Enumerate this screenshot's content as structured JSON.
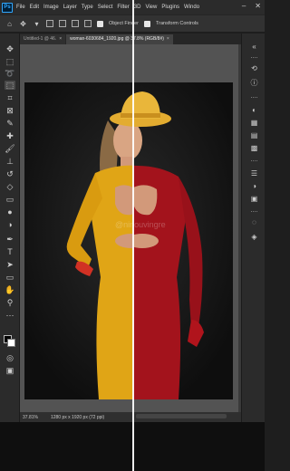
{
  "app": {
    "logo": "Ps",
    "menu": [
      "File",
      "Edit",
      "Image",
      "Layer",
      "Type",
      "Select",
      "Filter",
      "3D",
      "View",
      "Plugins",
      "Windo"
    ],
    "window_controls": [
      "minimize-icon",
      "close-icon"
    ]
  },
  "options_bar": {
    "auto_select_label": "Object Finder",
    "transform_label": "Transform Controls"
  },
  "tabs": [
    {
      "label": "Untitled-1 @ 46.",
      "active": false
    },
    {
      "label": "woman-6030684_1920.jpg @ 37.8% (RGB/8#)",
      "active": true
    }
  ],
  "status": {
    "zoom": "37.81%",
    "dimensions": "1280 px x 1920 px (72 ppi)"
  },
  "colors": {
    "dress_left": "#e0a516",
    "dress_right": "#a3131c",
    "hat": "#e9b63a",
    "background": "#161616"
  },
  "image": {
    "watermark": "@ninouvingre"
  }
}
